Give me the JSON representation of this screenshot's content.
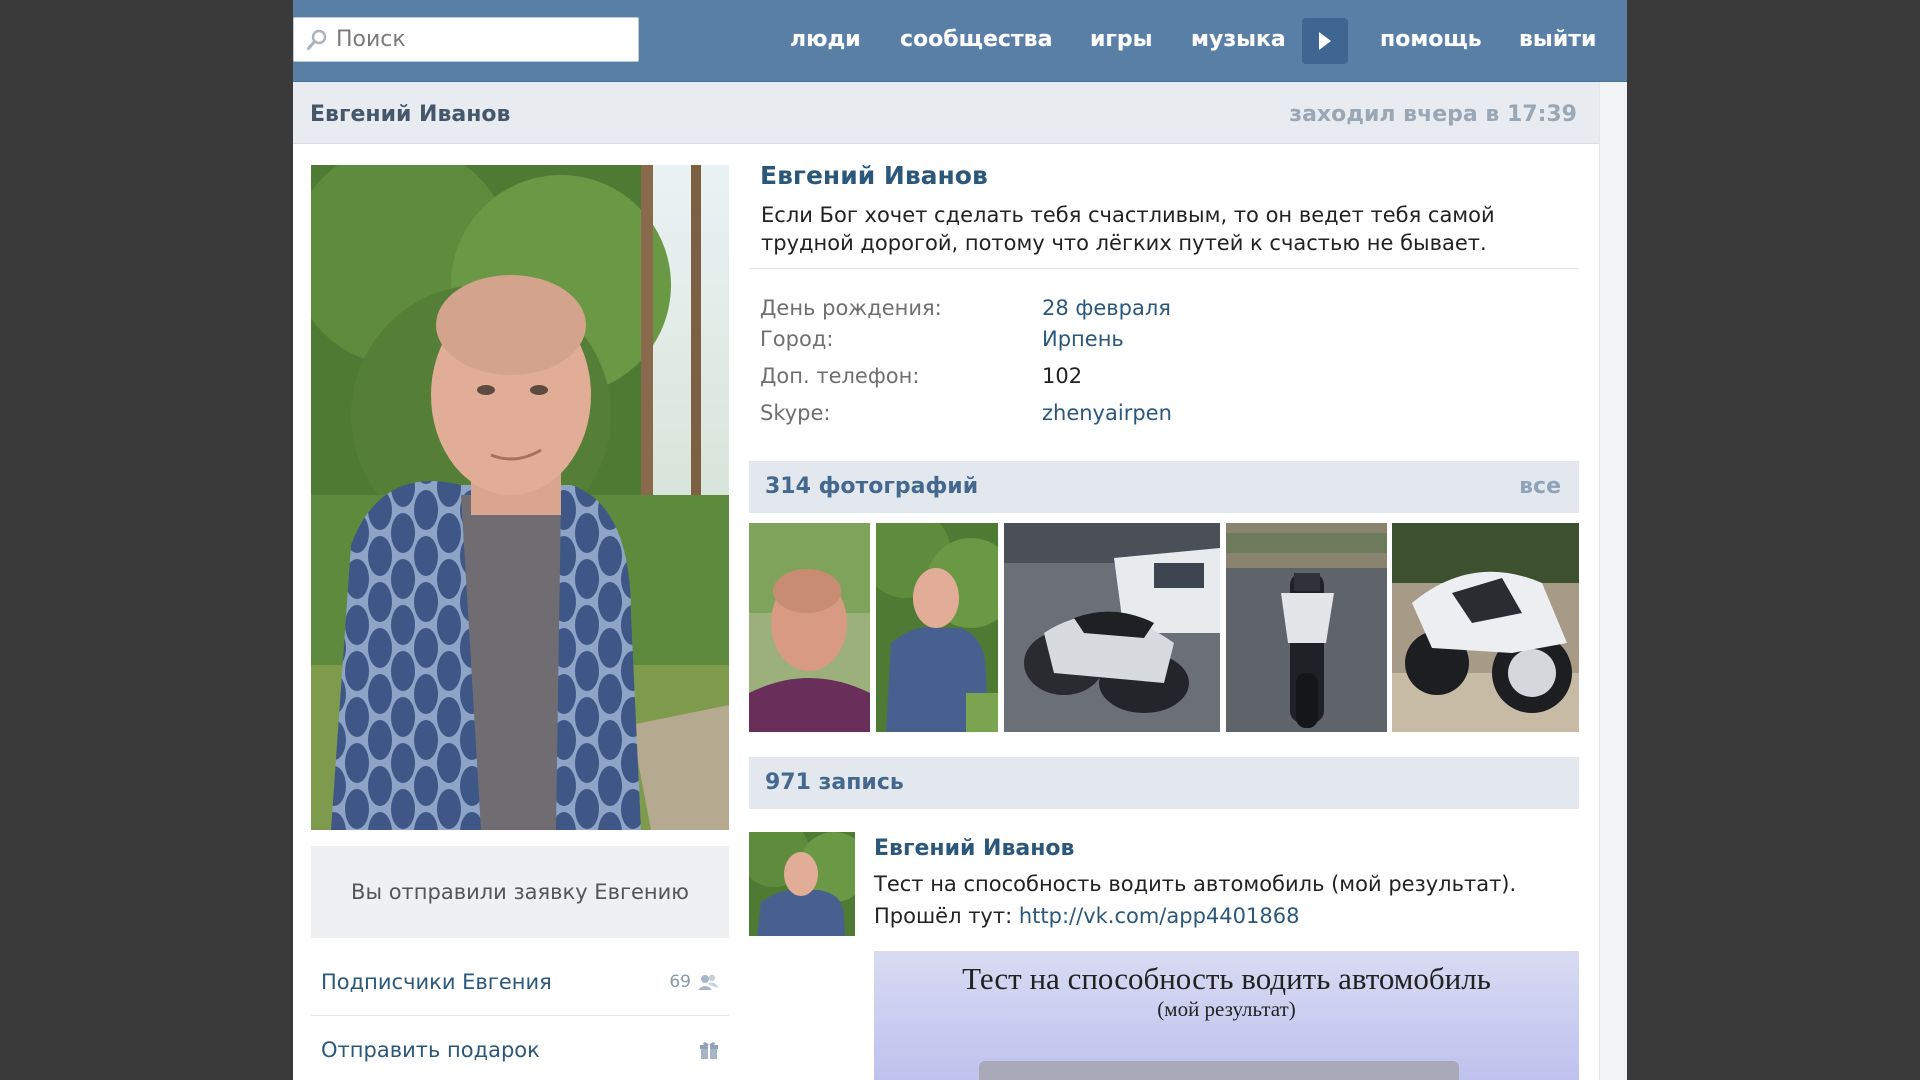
{
  "topbar": {
    "search_placeholder": "Поиск",
    "nav": [
      "люди",
      "сообщества",
      "игры",
      "музыка",
      "помощь",
      "выйти"
    ]
  },
  "header": {
    "name": "Евгений Иванов",
    "last_seen": "заходил вчера в 17:39"
  },
  "profile": {
    "name": "Евгений Иванов",
    "status": "Если Бог хочет сделать тебя счастливым, то он ведет тебя самой трудной дорогой, потому что лёгких путей к счастью не бывает.",
    "info": [
      {
        "label": "День рождения:",
        "value": "28 февраля"
      },
      {
        "label": "Город:",
        "value": "Ирпень"
      },
      {
        "label": "Доп. телефон:",
        "value": "102"
      },
      {
        "label": "Skype:",
        "value": "zhenyairpen"
      }
    ]
  },
  "sidebar": {
    "request_text": "Вы отправили заявку Евгению",
    "followers_label": "Подписчики Евгения",
    "followers_count": "69",
    "gift_label": "Отправить подарок"
  },
  "photos": {
    "title": "314 фотографий",
    "all_label": "все"
  },
  "wall": {
    "title": "971 запись",
    "post": {
      "author": "Евгений Иванов",
      "line1": "Тест на способность водить автомобиль (мой результат).",
      "line2_prefix": "Прошёл тут: ",
      "link": "http://vk.com/app4401868",
      "image_title": "Тест на способность водить автомобиль",
      "image_subtitle": "(мой результат)"
    }
  },
  "colors": {
    "topbar": "#5a7fa7",
    "link": "#2b587a",
    "section_bar": "#e3e8ee"
  }
}
